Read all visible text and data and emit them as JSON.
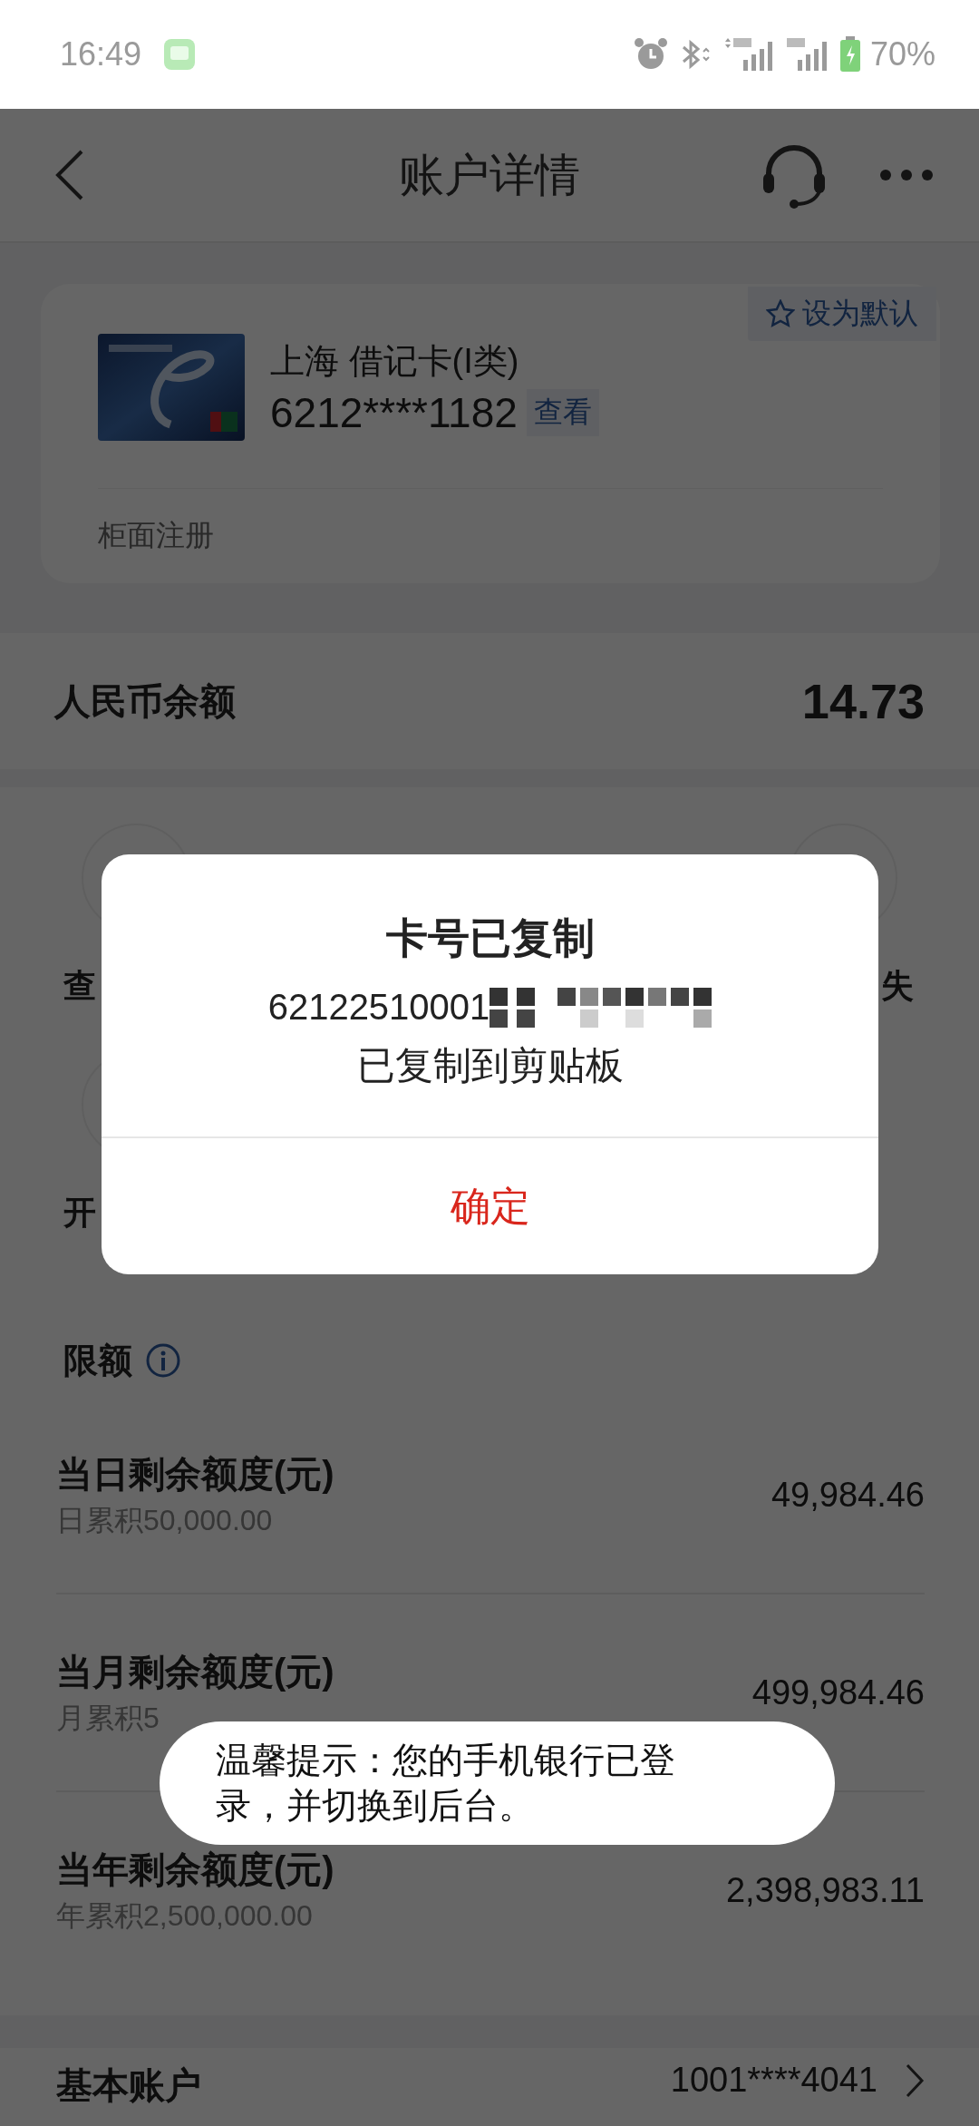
{
  "status_bar": {
    "time": "16:49",
    "battery": "70%"
  },
  "nav": {
    "title": "账户详情"
  },
  "card": {
    "tag": "设为默认",
    "name": "上海 借记卡(I类)",
    "number": "6212****1182",
    "view": "查看",
    "note": "柜面注册"
  },
  "balance": {
    "label": "人民币余额",
    "amount": "14.73"
  },
  "action_fragments": {
    "left": [
      "查",
      "开"
    ],
    "right": [
      "失"
    ]
  },
  "limits": {
    "title": "限额",
    "rows": [
      {
        "label": "当日剩余额度(元)",
        "sub": "日累积50,000.00",
        "value": "49,984.46"
      },
      {
        "label": "当月剩余额度(元)",
        "sub": "月累积5",
        "value": "499,984.46"
      },
      {
        "label": "当年剩余额度(元)",
        "sub": "年累积2,500,000.00",
        "value": "2,398,983.11"
      }
    ]
  },
  "account": {
    "label": "基本账户",
    "number": "1001****4041"
  },
  "dialog": {
    "title": "卡号已复制",
    "number": "62122510001",
    "message": "已复制到剪贴板",
    "button": "确定"
  },
  "toast": {
    "text": "温馨提示：您的手机银行已登录，并切换到后台。"
  }
}
